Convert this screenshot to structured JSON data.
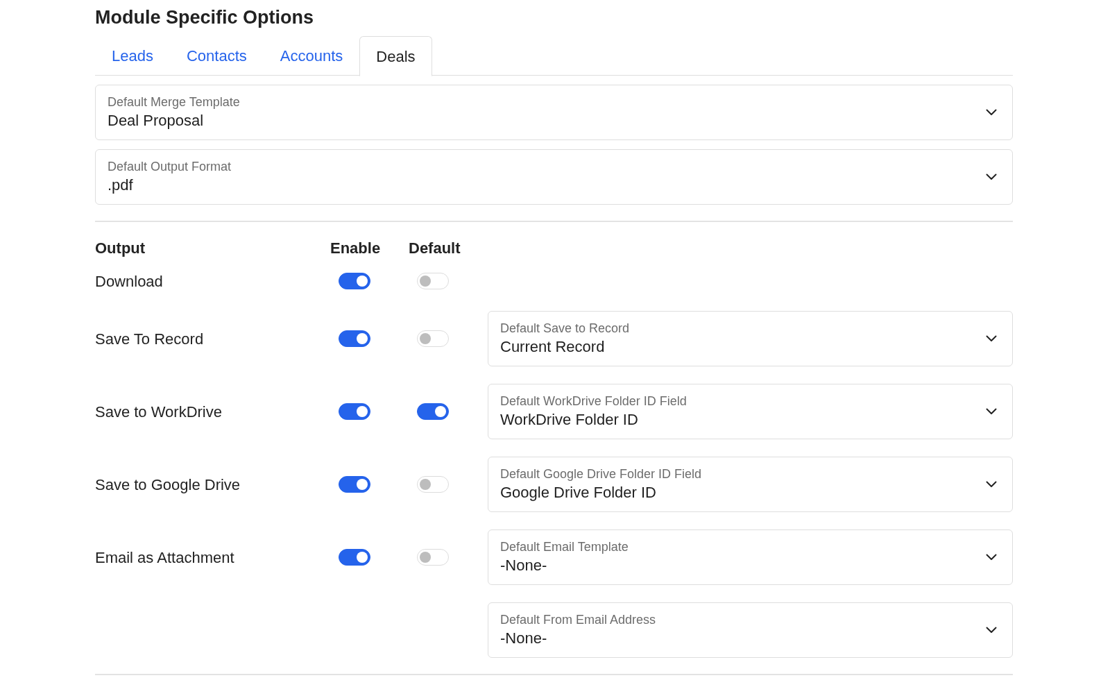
{
  "title": "Module Specific Options",
  "tabs": [
    {
      "label": "Leads",
      "selected": false
    },
    {
      "label": "Contacts",
      "selected": false
    },
    {
      "label": "Accounts",
      "selected": false
    },
    {
      "label": "Deals",
      "selected": true
    }
  ],
  "selects": [
    {
      "label": "Default Merge Template",
      "value": "Deal Proposal"
    },
    {
      "label": "Default Output Format",
      "value": ".pdf"
    }
  ],
  "output": {
    "headers": {
      "output": "Output",
      "enable": "Enable",
      "default": "Default"
    },
    "rows": [
      {
        "label": "Download",
        "enable": true,
        "default": false
      },
      {
        "label": "Save To Record",
        "enable": true,
        "default": false,
        "select": {
          "label": "Default Save to Record",
          "value": "Current Record"
        }
      },
      {
        "label": "Save to WorkDrive",
        "enable": true,
        "default": true,
        "select": {
          "label": "Default WorkDrive Folder ID Field",
          "value": "WorkDrive Folder ID"
        }
      },
      {
        "label": "Save to Google Drive",
        "enable": true,
        "default": false,
        "select": {
          "label": "Default Google Drive Folder ID Field",
          "value": "Google Drive Folder ID"
        }
      },
      {
        "label": "Email as Attachment",
        "enable": true,
        "default": false,
        "select": {
          "label": "Default Email Template",
          "value": "-None-"
        }
      },
      {
        "select": {
          "label": "Default From Email Address",
          "value": "-None-"
        }
      }
    ]
  }
}
